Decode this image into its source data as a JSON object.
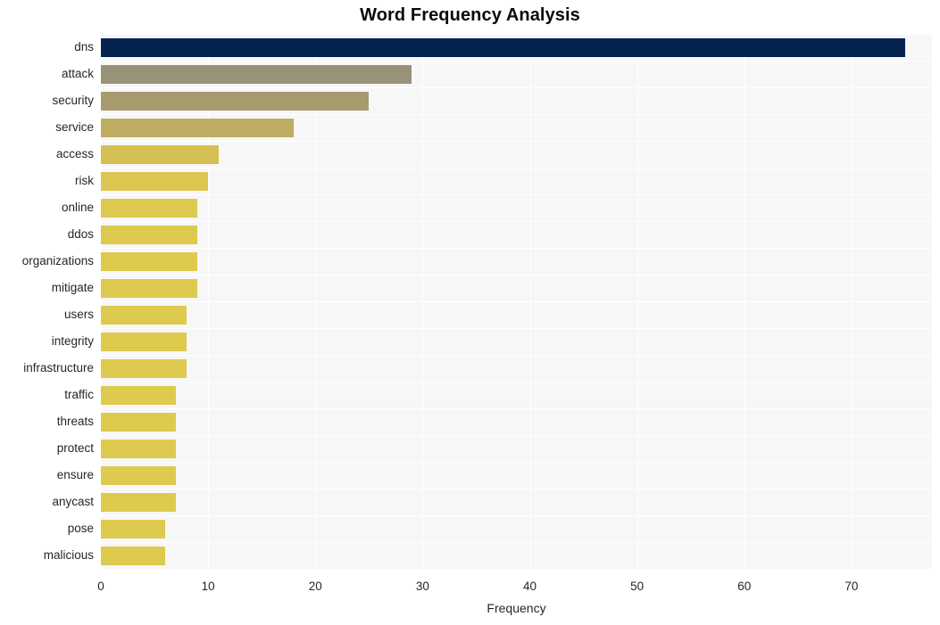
{
  "chart_data": {
    "type": "bar",
    "orientation": "horizontal",
    "title": "Word Frequency Analysis",
    "xlabel": "Frequency",
    "ylabel": "",
    "categories": [
      "dns",
      "attack",
      "security",
      "service",
      "access",
      "risk",
      "online",
      "ddos",
      "organizations",
      "mitigate",
      "users",
      "integrity",
      "infrastructure",
      "traffic",
      "threats",
      "protect",
      "ensure",
      "anycast",
      "pose",
      "malicious"
    ],
    "values": [
      75,
      29,
      25,
      18,
      11,
      10,
      9,
      9,
      9,
      9,
      8,
      8,
      8,
      7,
      7,
      7,
      7,
      7,
      6,
      6
    ],
    "bar_colors": [
      "#042350",
      "#989279",
      "#a59b6f",
      "#bdad63",
      "#d5c053",
      "#dcc64f",
      "#ddc94e",
      "#ddc94e",
      "#ddc94e",
      "#ddc94e",
      "#ddca4e",
      "#ddca4e",
      "#ddca4e",
      "#ddca4e",
      "#ddca4e",
      "#ddca4e",
      "#ddca4e",
      "#ddca4e",
      "#ddca4e",
      "#ddca4e"
    ],
    "xticks": [
      0,
      10,
      20,
      30,
      40,
      50,
      60,
      70
    ],
    "xtick_labels": [
      "0",
      "10",
      "20",
      "30",
      "40",
      "50",
      "60",
      "70"
    ],
    "xlim": [
      0,
      77.5
    ],
    "grid": true,
    "grid_color": "#ffffff",
    "plot_background": "#f7f7f7",
    "figure_background": "#ffffff",
    "legend": null
  }
}
